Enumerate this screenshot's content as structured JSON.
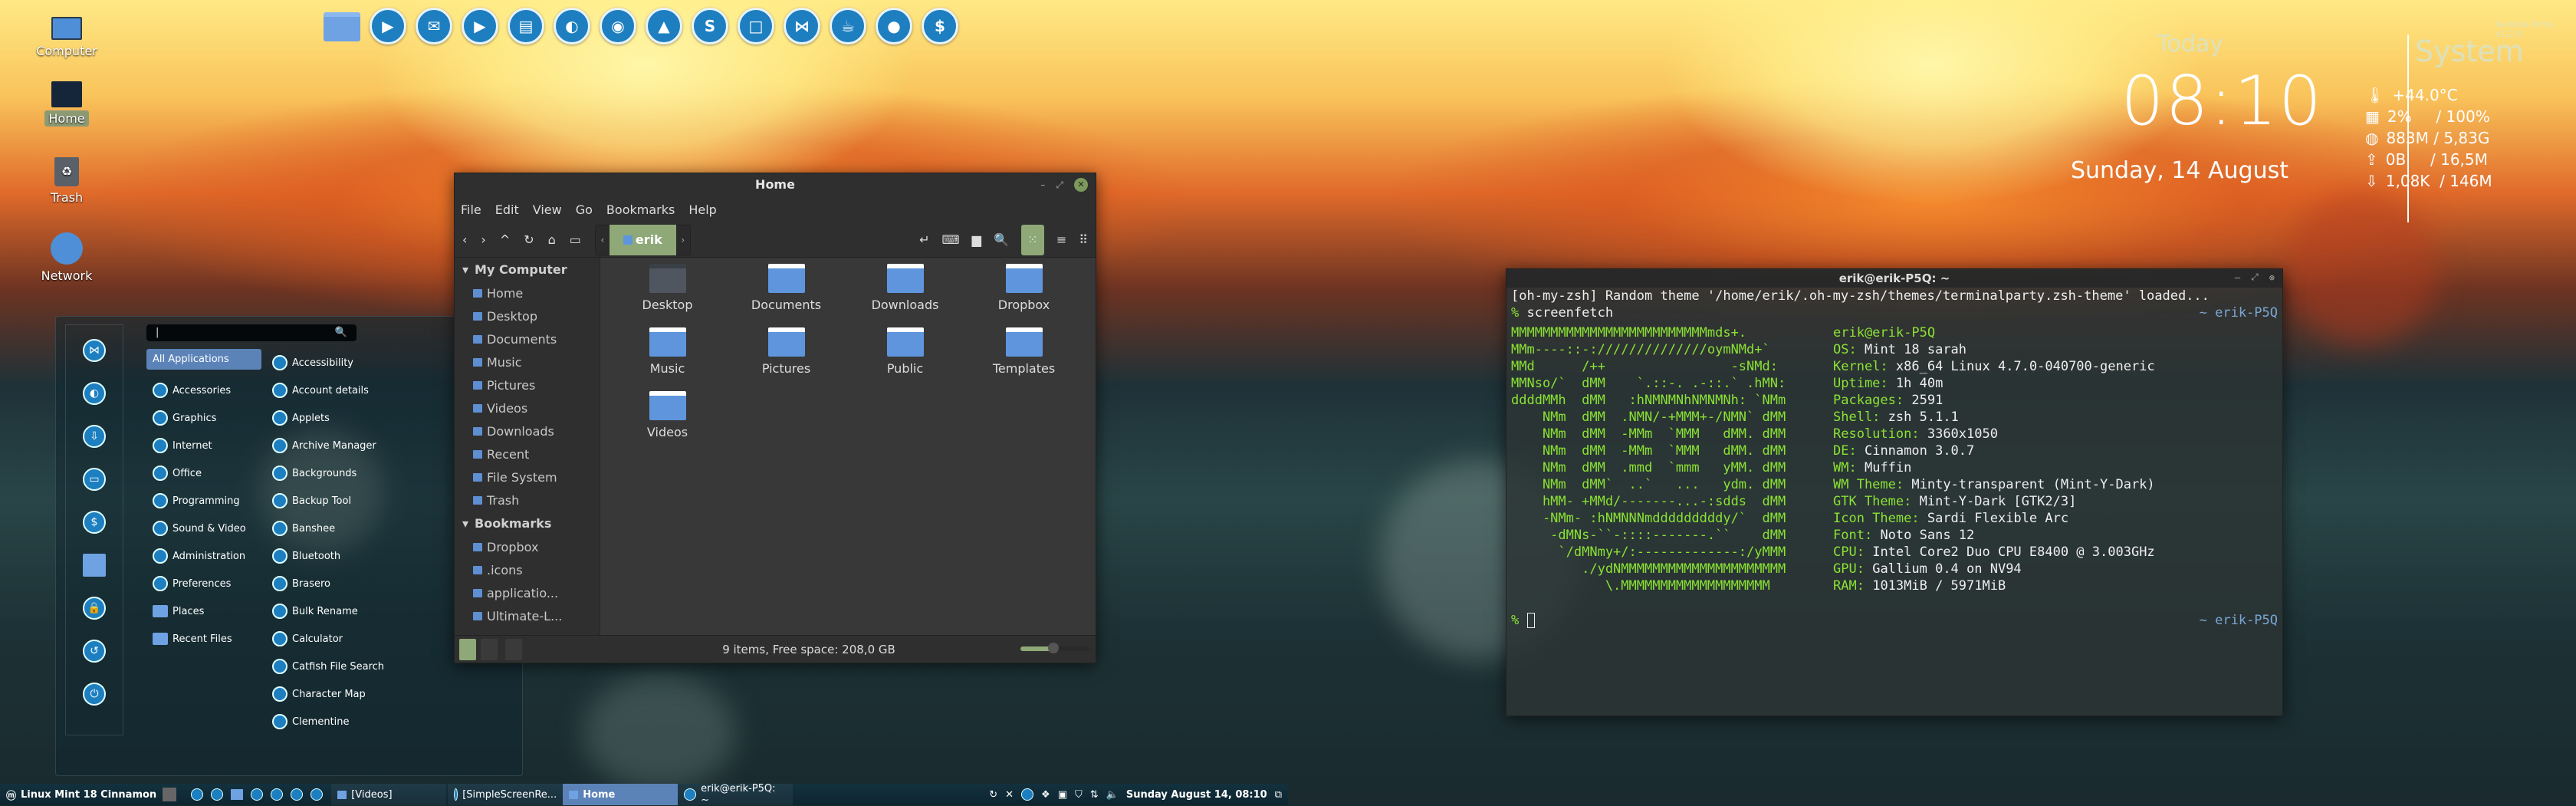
{
  "desktop": {
    "icons": [
      {
        "name": "computer",
        "label": "Computer"
      },
      {
        "name": "home",
        "label": "Home"
      },
      {
        "name": "trash",
        "label": "Trash"
      },
      {
        "name": "network",
        "label": "Network"
      }
    ]
  },
  "dock": {
    "apps": [
      "files-icon",
      "video-player-icon",
      "thunderbird-icon",
      "video-player-icon",
      "document-viewer-icon",
      "firefox-icon",
      "eye-icon",
      "inkscape-icon",
      "skype-icon",
      "screenshot-icon",
      "bow-tie-icon",
      "teapot-icon",
      "screen-recorder-icon",
      "terminal-icon"
    ]
  },
  "widget": {
    "today_label": "Today",
    "time": "08:10",
    "date": "Sunday, 14 August",
    "system_label": "System",
    "version": "Aureola Acros v1.2.0",
    "stats": [
      {
        "icon": "thermometer-icon",
        "text": "+44.0°C"
      },
      {
        "icon": "cpu-icon",
        "text": "2%     / 100%"
      },
      {
        "icon": "memory-icon",
        "text": "883M / 5,83G"
      },
      {
        "icon": "upload-icon",
        "text": "0B     / 16,5M"
      },
      {
        "icon": "download-icon",
        "text": "1,08K  / 146M"
      }
    ]
  },
  "file_manager": {
    "title": "Home",
    "menu": [
      "File",
      "Edit",
      "View",
      "Go",
      "Bookmarks",
      "Help"
    ],
    "breadcrumb": "erik",
    "sidebar": {
      "my_computer_header": "My Computer",
      "my_computer": [
        "Home",
        "Desktop",
        "Documents",
        "Music",
        "Pictures",
        "Videos",
        "Downloads",
        "Recent",
        "File System",
        "Trash"
      ],
      "bookmarks_header": "Bookmarks",
      "bookmarks": [
        "Dropbox",
        ".icons",
        "applicatio...",
        "Ultimate-L..."
      ]
    },
    "items": [
      "Desktop",
      "Documents",
      "Downloads",
      "Dropbox",
      "Music",
      "Pictures",
      "Public",
      "Templates",
      "Videos"
    ],
    "status": "9 items, Free space: 208,0 GB",
    "zoom_level_fraction": 0.45
  },
  "menu": {
    "search_value": "",
    "favorites": [
      "bow-tie-icon",
      "firefox-icon",
      "download-icon",
      "screen-icon",
      "terminal-icon",
      "folder-icon",
      "lock-icon",
      "logout-icon",
      "power-icon"
    ],
    "categories": [
      "All Applications",
      "Accessories",
      "Graphics",
      "Internet",
      "Office",
      "Programming",
      "Sound & Video",
      "Administration",
      "Preferences",
      "Places",
      "Recent Files"
    ],
    "apps": [
      "Accessibility",
      "Account details",
      "Applets",
      "Archive Manager",
      "Backgrounds",
      "Backup Tool",
      "Banshee",
      "Bluetooth",
      "Brasero",
      "Bulk Rename",
      "Calculator",
      "Catfish File Search",
      "Character Map",
      "Clementine"
    ]
  },
  "taskbar": {
    "start_label": "Linux Mint 18 Cinnamon",
    "windows": [
      {
        "label": "[Videos]",
        "active": false
      },
      {
        "label": "[SimpleScreenRe...",
        "active": false
      },
      {
        "label": "Home",
        "active": true
      },
      {
        "label": "erik@erik-P5Q: ~",
        "active": false
      }
    ],
    "clock": "Sunday August 14, 08:10"
  },
  "terminal": {
    "title": "erik@erik-P5Q: ~",
    "line1": "[oh-my-zsh] Random theme '/home/erik/.oh-my-zsh/themes/terminalparty.zsh-theme' loaded...",
    "prompt_symbol": "%",
    "command": "screenfetch",
    "rprompt": "~ erik-P5Q",
    "logo": [
      "MMMMMMMMMMMMMMMMMMMMMMMMMmds+.",
      "MMm----::-://////////////oymNMd+`",
      "MMd      /++                -sNMd:",
      "MMNso/`  dMM    `.::-. .-::.` .hMN:",
      "ddddMMh  dMM   :hNMNMNhNMNMNh: `NMm",
      "    NMm  dMM  .NMN/-+MMM+-/NMN` dMM",
      "    NMm  dMM  -MMm  `MMM   dMM. dMM",
      "    NMm  dMM  -MMm  `MMM   dMM. dMM",
      "    NMm  dMM  .mmd  `mmm   yMM. dMM",
      "    NMm  dMM`  ..`   ...   ydm. dMM",
      "    hMM- +MMd/-------...-:sdds  dMM",
      "    -NMm- :hNMNNNmdddddddddy/`  dMM",
      "     -dMNs-``-::::-------.``    dMM",
      "      `/dMNmy+/:-------------:/yMMM",
      "         ./ydNMMMMMMMMMMMMMMMMMMMMM",
      "            \\.MMMMMMMMMMMMMMMMMMM"
    ],
    "info_user": "erik@erik-P5Q",
    "info": [
      {
        "key": "OS:",
        "value": "Mint 18 sarah"
      },
      {
        "key": "Kernel:",
        "value": "x86_64 Linux 4.7.0-040700-generic"
      },
      {
        "key": "Uptime:",
        "value": "1h 40m"
      },
      {
        "key": "Packages:",
        "value": "2591"
      },
      {
        "key": "Shell:",
        "value": "zsh 5.1.1"
      },
      {
        "key": "Resolution:",
        "value": "3360x1050"
      },
      {
        "key": "DE:",
        "value": "Cinnamon 3.0.7"
      },
      {
        "key": "WM:",
        "value": "Muffin"
      },
      {
        "key": "WM Theme:",
        "value": "Minty-transparent (Mint-Y-Dark)"
      },
      {
        "key": "GTK Theme:",
        "value": "Mint-Y-Dark [GTK2/3]"
      },
      {
        "key": "Icon Theme:",
        "value": "Sardi Flexible Arc"
      },
      {
        "key": "Font:",
        "value": "Noto Sans 12"
      },
      {
        "key": "CPU:",
        "value": "Intel Core2 Duo CPU E8400 @ 3.003GHz"
      },
      {
        "key": "GPU:",
        "value": "Gallium 0.4 on NV94"
      },
      {
        "key": "RAM:",
        "value": "1013MiB / 5971MiB"
      }
    ]
  },
  "colors": {
    "accent": "#8fa877",
    "menu_selected": "#5b83b8",
    "terminal_green": "#8ae234",
    "folder_blue": "#5e95dd"
  }
}
